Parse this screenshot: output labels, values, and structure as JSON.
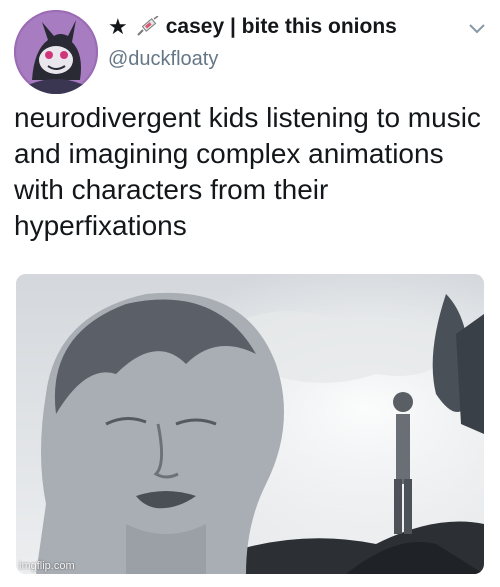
{
  "tweet": {
    "display_name": "casey | bite this onions",
    "handle": "@duckfloaty",
    "text": "neurodivergent kids listening to music and imagining complex animations with characters from their hyperfixations"
  },
  "icons": {
    "name_prefix": [
      "star-icon",
      "syringe-icon"
    ],
    "menu": "chevron-down-icon"
  },
  "watermark": "imgflip.com",
  "colors": {
    "text_primary": "#14171a",
    "text_secondary": "#657786",
    "background": "#ffffff"
  }
}
